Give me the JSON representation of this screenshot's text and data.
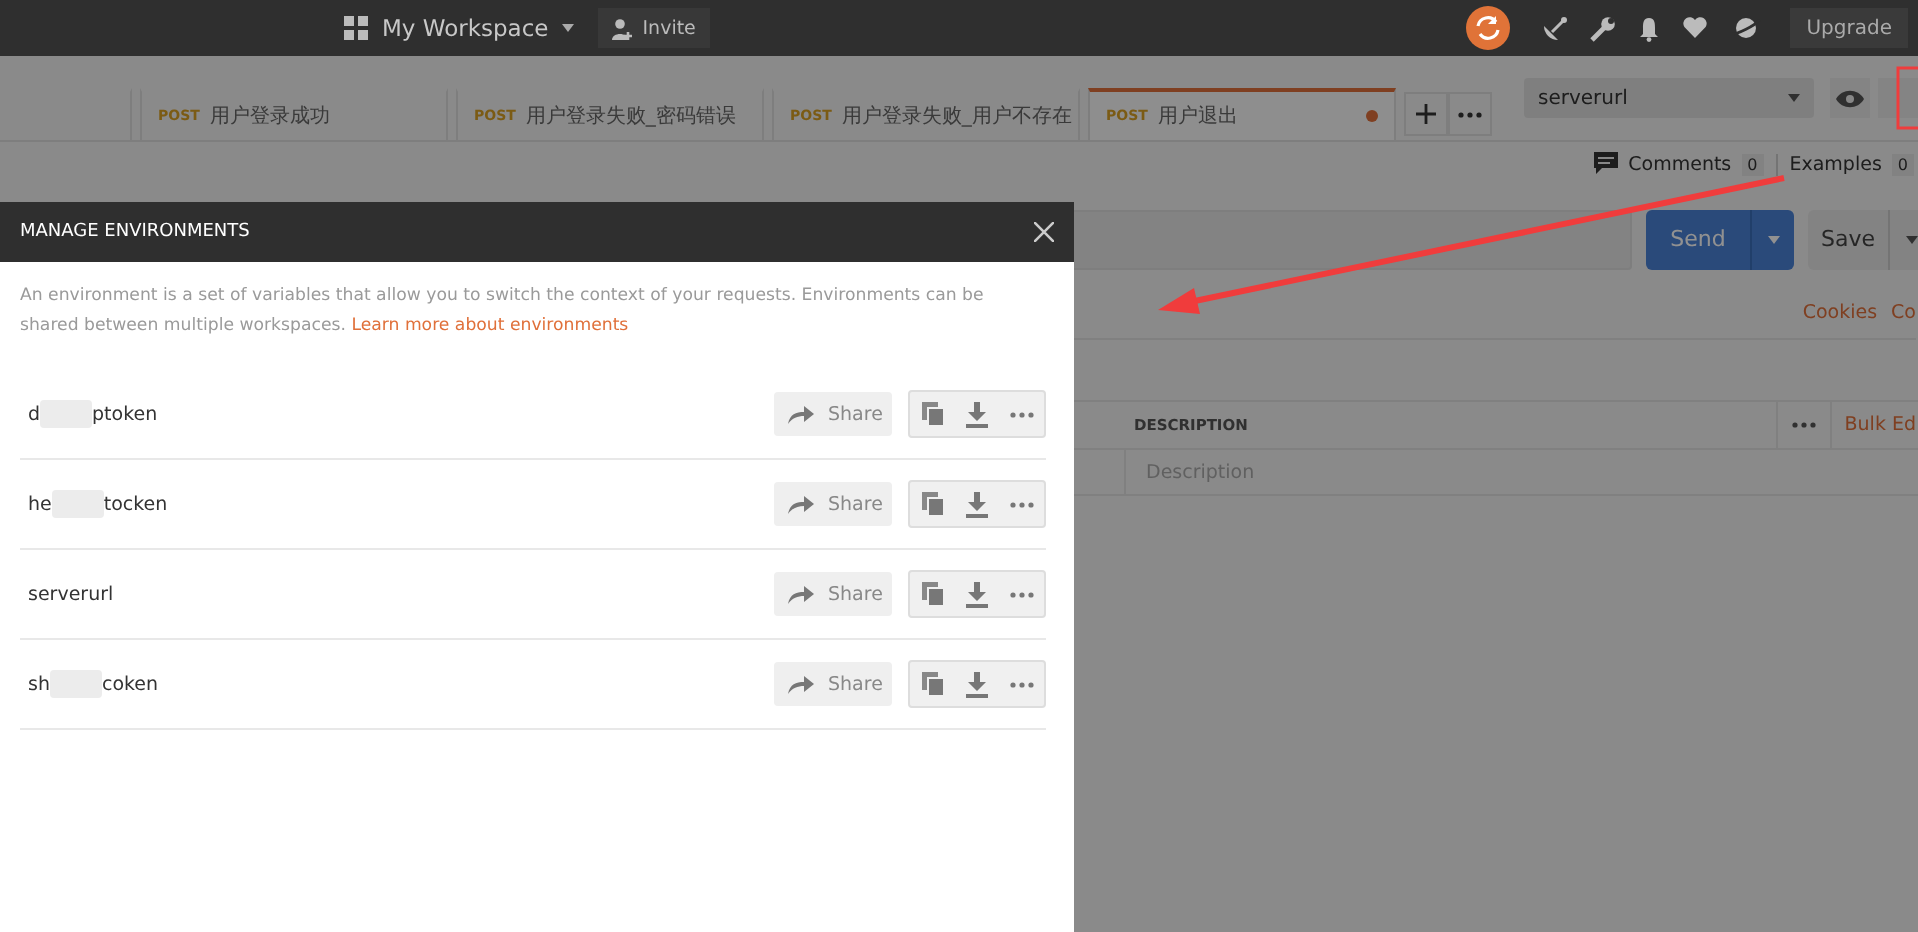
{
  "header": {
    "workspace": "My Workspace",
    "invite": "Invite",
    "upgrade": "Upgrade"
  },
  "tabs": [
    {
      "method": "POST",
      "title": "用户登录成功",
      "selected": false,
      "unsaved": false
    },
    {
      "method": "POST",
      "title": "用户登录失败_密码错误",
      "selected": false,
      "unsaved": false
    },
    {
      "method": "POST",
      "title": "用户登录失败_用户不存在",
      "selected": false,
      "unsaved": false
    },
    {
      "method": "POST",
      "title": "用户退出",
      "selected": true,
      "unsaved": true
    }
  ],
  "environment_select": {
    "value": "serverurl"
  },
  "request": {
    "comments": {
      "label": "Comments",
      "count": "0"
    },
    "examples": {
      "label": "Examples",
      "count": "0"
    },
    "send": "Send",
    "save": "Save",
    "links": [
      "Cookies",
      "Co"
    ],
    "table": {
      "column": "DESCRIPTION",
      "bulk_edit": "Bulk Ed",
      "placeholder": "Description"
    }
  },
  "modal": {
    "title": "MANAGE ENVIRONMENTS",
    "description": "An environment is a set of variables that allow you to switch the context of your requests. Environments can be shared between multiple workspaces.",
    "link": "Learn more about environments",
    "environments": [
      {
        "name_start": "d",
        "name_end": "ptoken",
        "redacted": true,
        "share": "Share"
      },
      {
        "name_start": "he",
        "name_end": "tocken",
        "redacted": true,
        "share": "Share"
      },
      {
        "name_start": "serverurl",
        "redacted": false,
        "share": "Share"
      },
      {
        "name_start": "sh",
        "name_end": "coken",
        "redacted": true,
        "share": "Share"
      }
    ]
  }
}
